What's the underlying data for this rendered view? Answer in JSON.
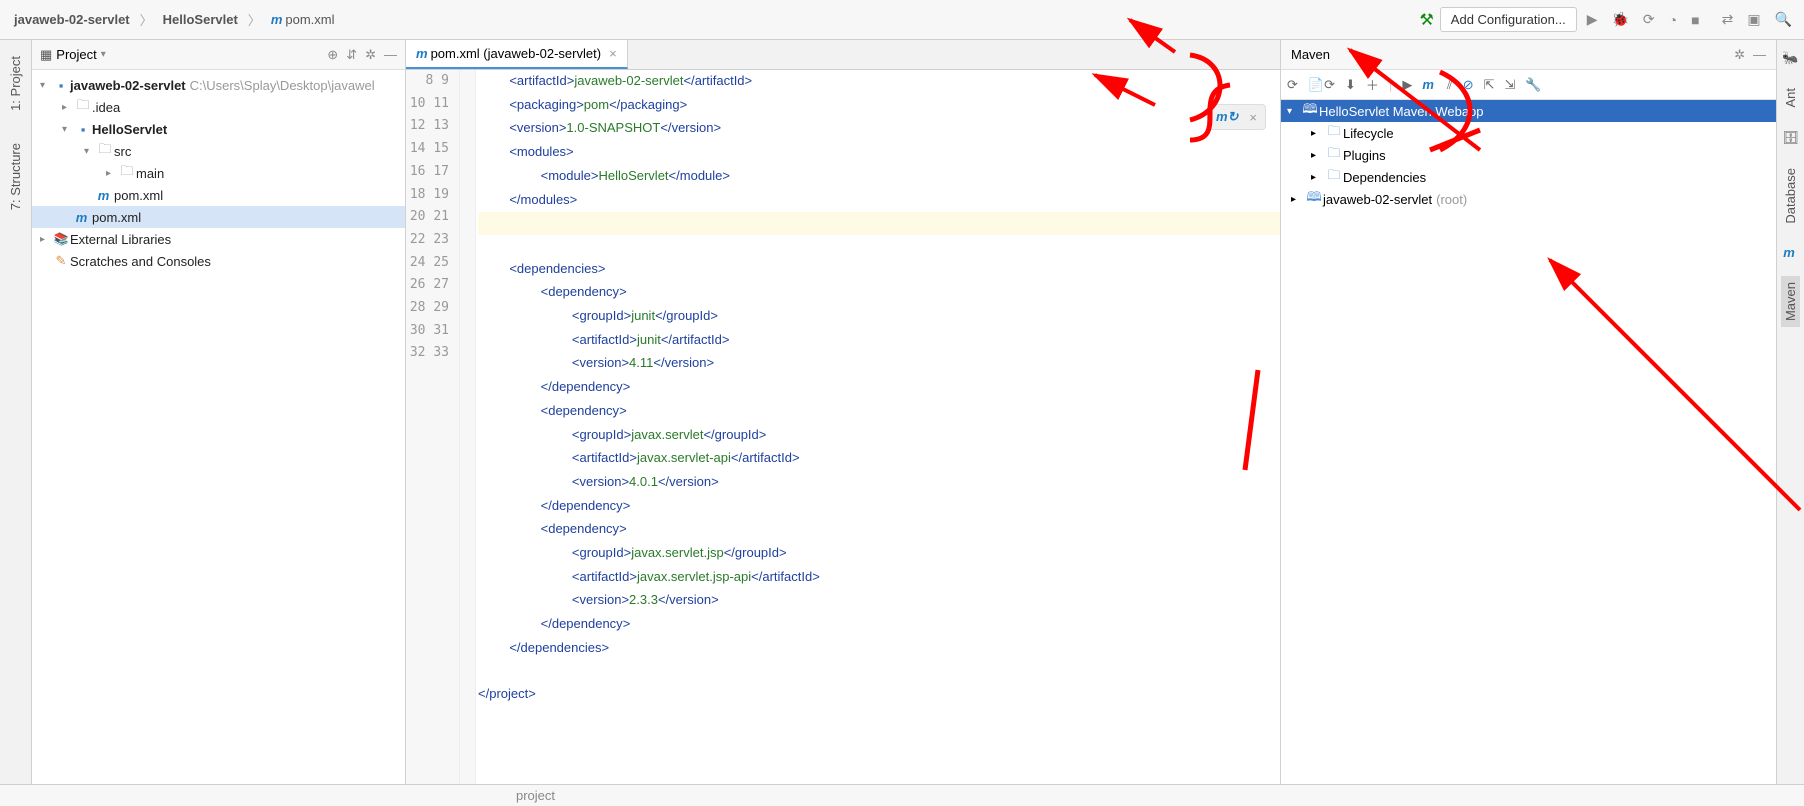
{
  "breadcrumb": {
    "project": "javaweb-02-servlet",
    "module": "HelloServlet",
    "file": "pom.xml"
  },
  "top": {
    "config_label": "Add Configuration..."
  },
  "left_gutter": {
    "project": "1: Project",
    "structure": "7: Structure"
  },
  "project_panel": {
    "title": "Project",
    "tree": {
      "root": "javaweb-02-servlet",
      "root_path": "C:\\Users\\Splay\\Desktop\\javawel",
      "idea": ".idea",
      "hello": "HelloServlet",
      "src": "src",
      "main": "main",
      "pom_child": "pom.xml",
      "pom_root": "pom.xml",
      "ext_lib": "External Libraries",
      "scratches": "Scratches and Consoles"
    }
  },
  "editor": {
    "tab": "pom.xml (javaweb-02-servlet)",
    "status_crumb": "project",
    "lines": {
      "start": 8,
      "end": 33
    },
    "code": {
      "l8_artifactId": "javaweb-02-servlet",
      "l9_packaging": "pom",
      "l10_version": "1.0-SNAPSHOT",
      "l12_module": "HelloServlet",
      "dep1_group": "junit",
      "dep1_artifact": "junit",
      "dep1_version": "4.11",
      "dep2_group": "javax.servlet",
      "dep2_artifact": "javax.servlet-api",
      "dep2_version": "4.0.1",
      "dep3_group": "javax.servlet.jsp",
      "dep3_artifact": "javax.servlet.jsp-api",
      "dep3_version": "2.3.3"
    }
  },
  "maven": {
    "title": "Maven",
    "root": "HelloServlet Maven Webapp",
    "lifecycle": "Lifecycle",
    "plugins": "Plugins",
    "dependencies": "Dependencies",
    "project2": "javaweb-02-servlet",
    "project2_suffix": "(root)"
  },
  "right_gutter": {
    "ant": "Ant",
    "database": "Database",
    "maven": "Maven"
  }
}
